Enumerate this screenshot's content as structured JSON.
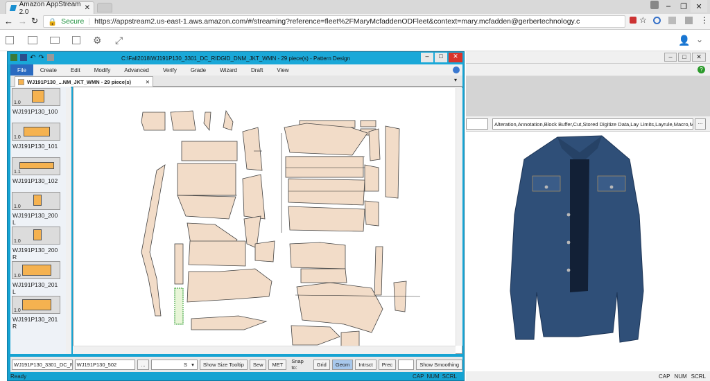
{
  "browser": {
    "tab_title": "Amazon AppStream 2.0",
    "secure_label": "Secure",
    "url": "https://appstream2.us-east-1.aws.amazon.com/#/streaming?reference=fleet%2FMaryMcfaddenODFleet&context=mary.mcfadden@gerbertechnology.c"
  },
  "window": {
    "title": "C:\\Fall2018\\WJ191P130_3301_DC_RIDGID_DNM_JKT_WMN - 29 piece(s) - Pattern Design"
  },
  "menu": [
    "File",
    "Create",
    "Edit",
    "Modify",
    "Advanced",
    "Verify",
    "Grade",
    "Wizard",
    "Draft",
    "View"
  ],
  "doc_tab": "WJ191P130_...NM_JKT_WMN - 29 piece(s)",
  "pieces": [
    {
      "qty": "1.0",
      "label": "WJ191P130_100"
    },
    {
      "qty": "1.0",
      "label": "WJ191P130_101"
    },
    {
      "qty": "1.1",
      "label": "WJ191P130_102"
    },
    {
      "qty": "1.0",
      "label": "WJ191P130_200",
      "suffix": "L"
    },
    {
      "qty": "1.0",
      "label": "WJ191P130_200",
      "suffix": "R"
    },
    {
      "qty": "1.0",
      "label": "WJ191P130_201",
      "suffix": "L"
    },
    {
      "qty": "1.0",
      "label": "WJ191P130_201",
      "suffix": "R"
    }
  ],
  "bottombar": {
    "field1": "WJ191P130_3301_DC_RIDG",
    "field2": "WJ191P130_502",
    "ellipsis": "...",
    "size_value": "S",
    "show_size_tooltip": "Show Size Tooltip",
    "sew": "Sew",
    "met": "MET",
    "snap_to": "Snap to:",
    "grid": "Grid",
    "geom": "Geom",
    "intrsct": "Intrsct",
    "prec": "Prec",
    "show_smoothing": "Show Smoothing"
  },
  "status": {
    "left": "Ready",
    "cap": "CAP",
    "num": "NUM",
    "scrl": "SCRL"
  },
  "right_panel": {
    "options_text": "Alteration,Annotation,Block Buffer,Cut,Stored Digitize Data,Lay Limits,Layrule,Macro,Mar",
    "ellipsis": "...",
    "cap": "CAP",
    "num": "NUM",
    "scrl": "SCRL"
  },
  "colors": {
    "window_frame": "#16a3d2",
    "piece_fill": "#f2dcc8",
    "thumb_fill": "#f5b250",
    "close_red": "#d9332a",
    "menu_selected": "#2a6ac0"
  }
}
